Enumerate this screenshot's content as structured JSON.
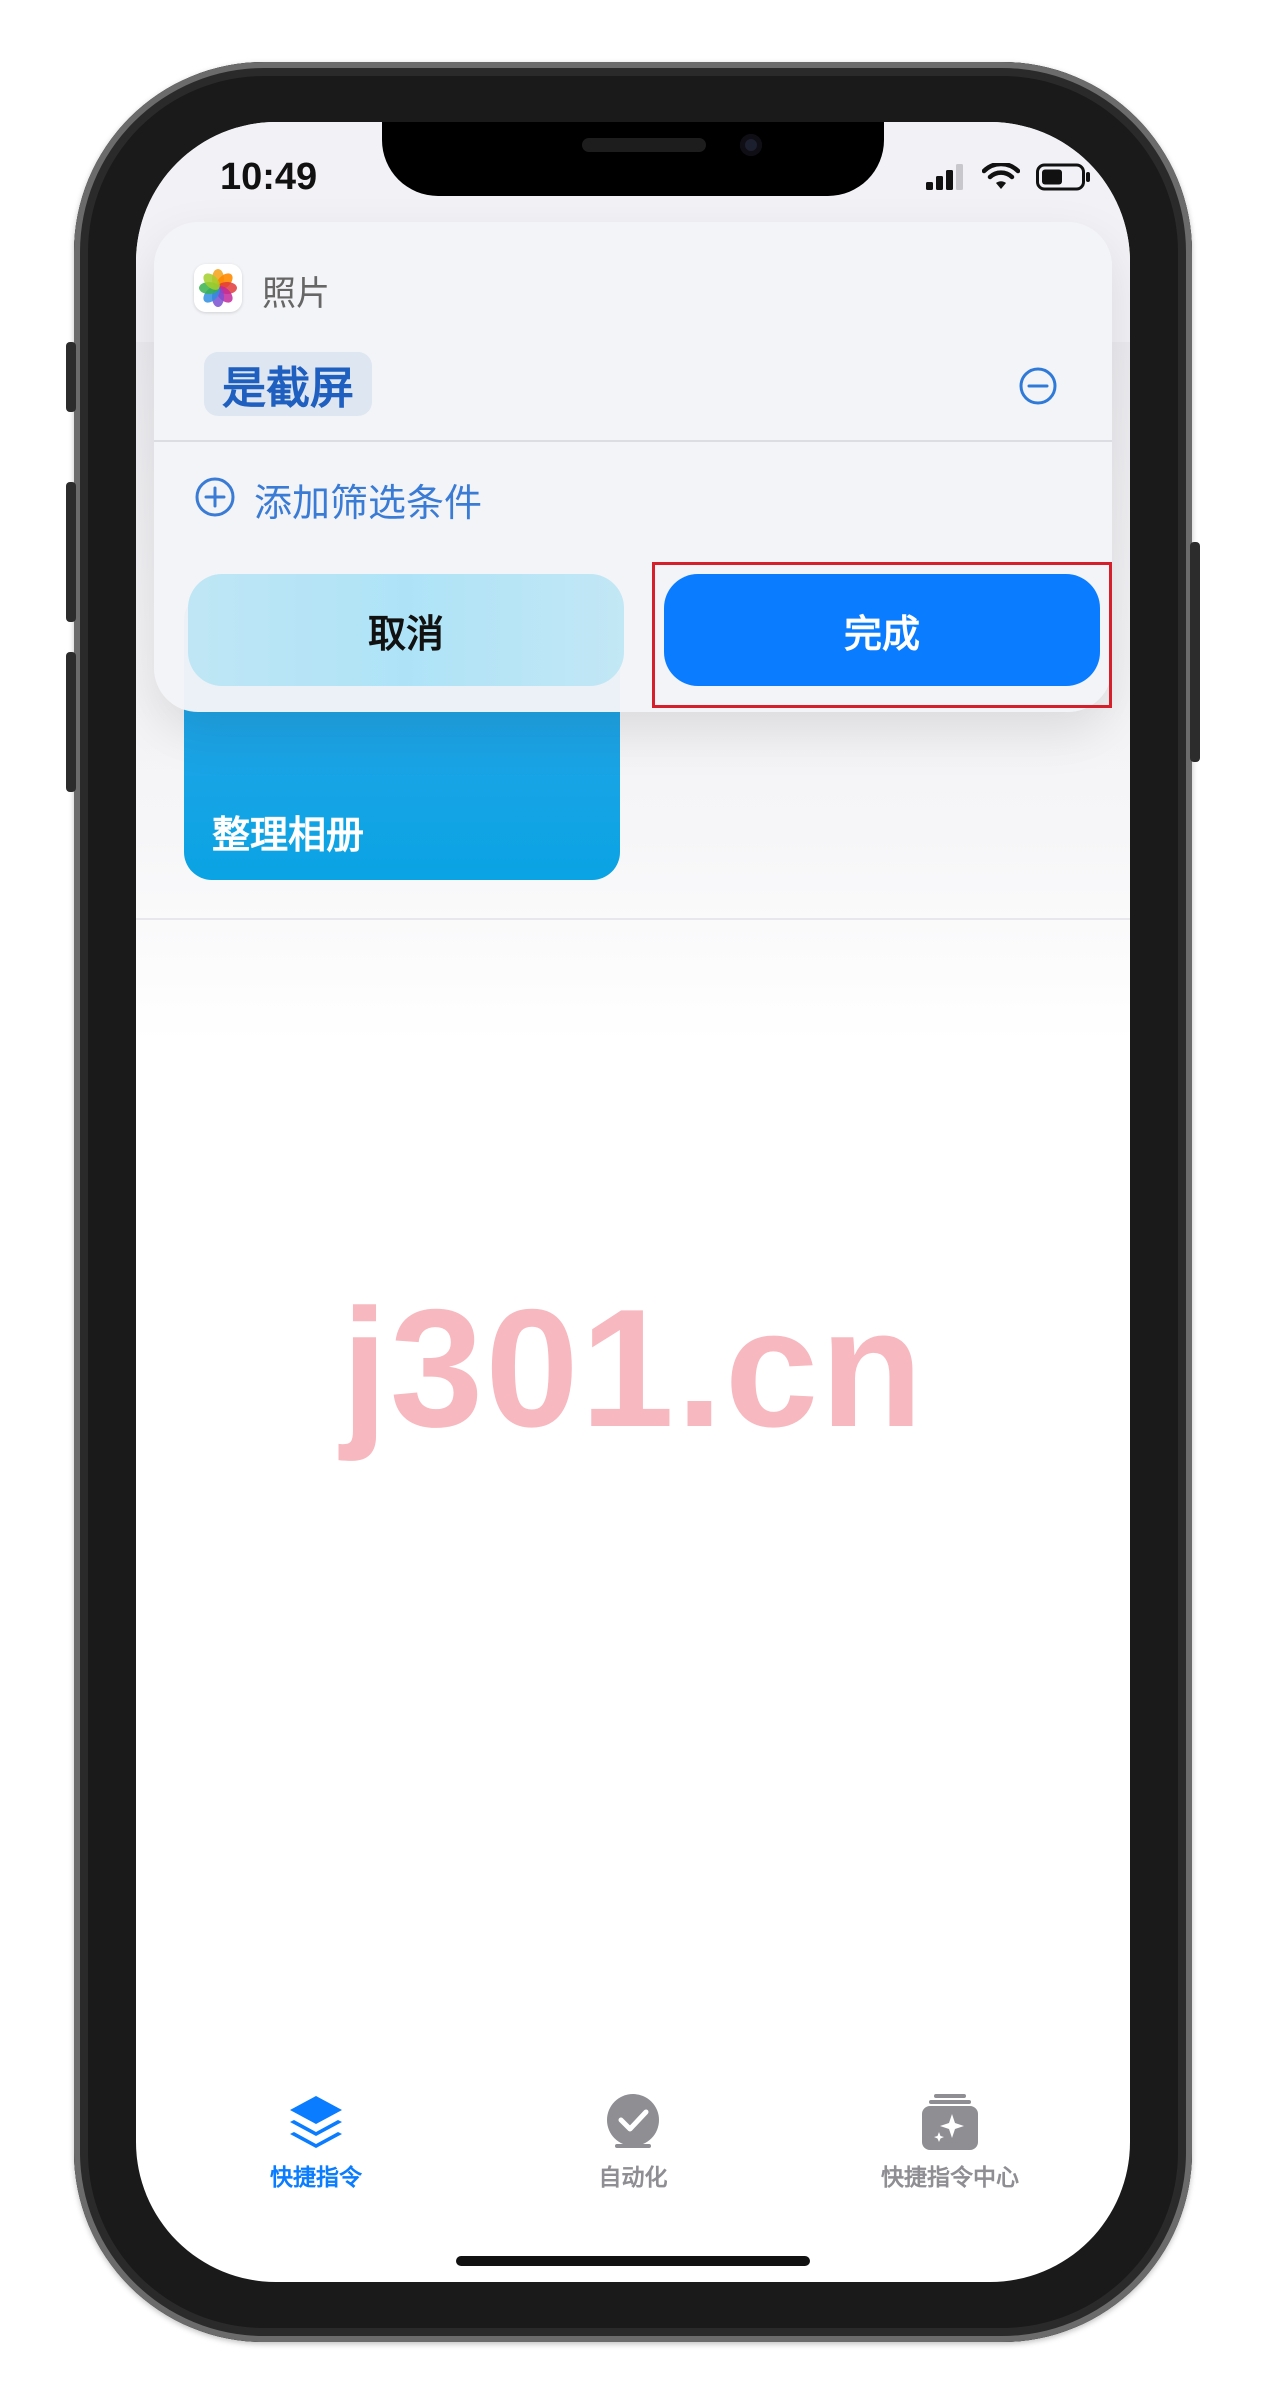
{
  "status_bar": {
    "time": "10:49"
  },
  "background": {
    "card_title": "整理相册",
    "card_color": "#0aa3e3"
  },
  "filter_panel": {
    "app_name": "照片",
    "filter_chip": "是截屏",
    "add_filter_label": "添加筛选条件",
    "cancel_label": "取消",
    "done_label": "完成",
    "accent_color": "#0a7cff",
    "highlight_color": "#d51f2a"
  },
  "watermark": "j301.cn",
  "tab_bar": {
    "items": [
      {
        "label": "快捷指令",
        "icon": "layers-icon",
        "active": true
      },
      {
        "label": "自动化",
        "icon": "clock-check-icon",
        "active": false
      },
      {
        "label": "快捷指令中心",
        "icon": "gallery-sparkle-icon",
        "active": false
      }
    ]
  }
}
